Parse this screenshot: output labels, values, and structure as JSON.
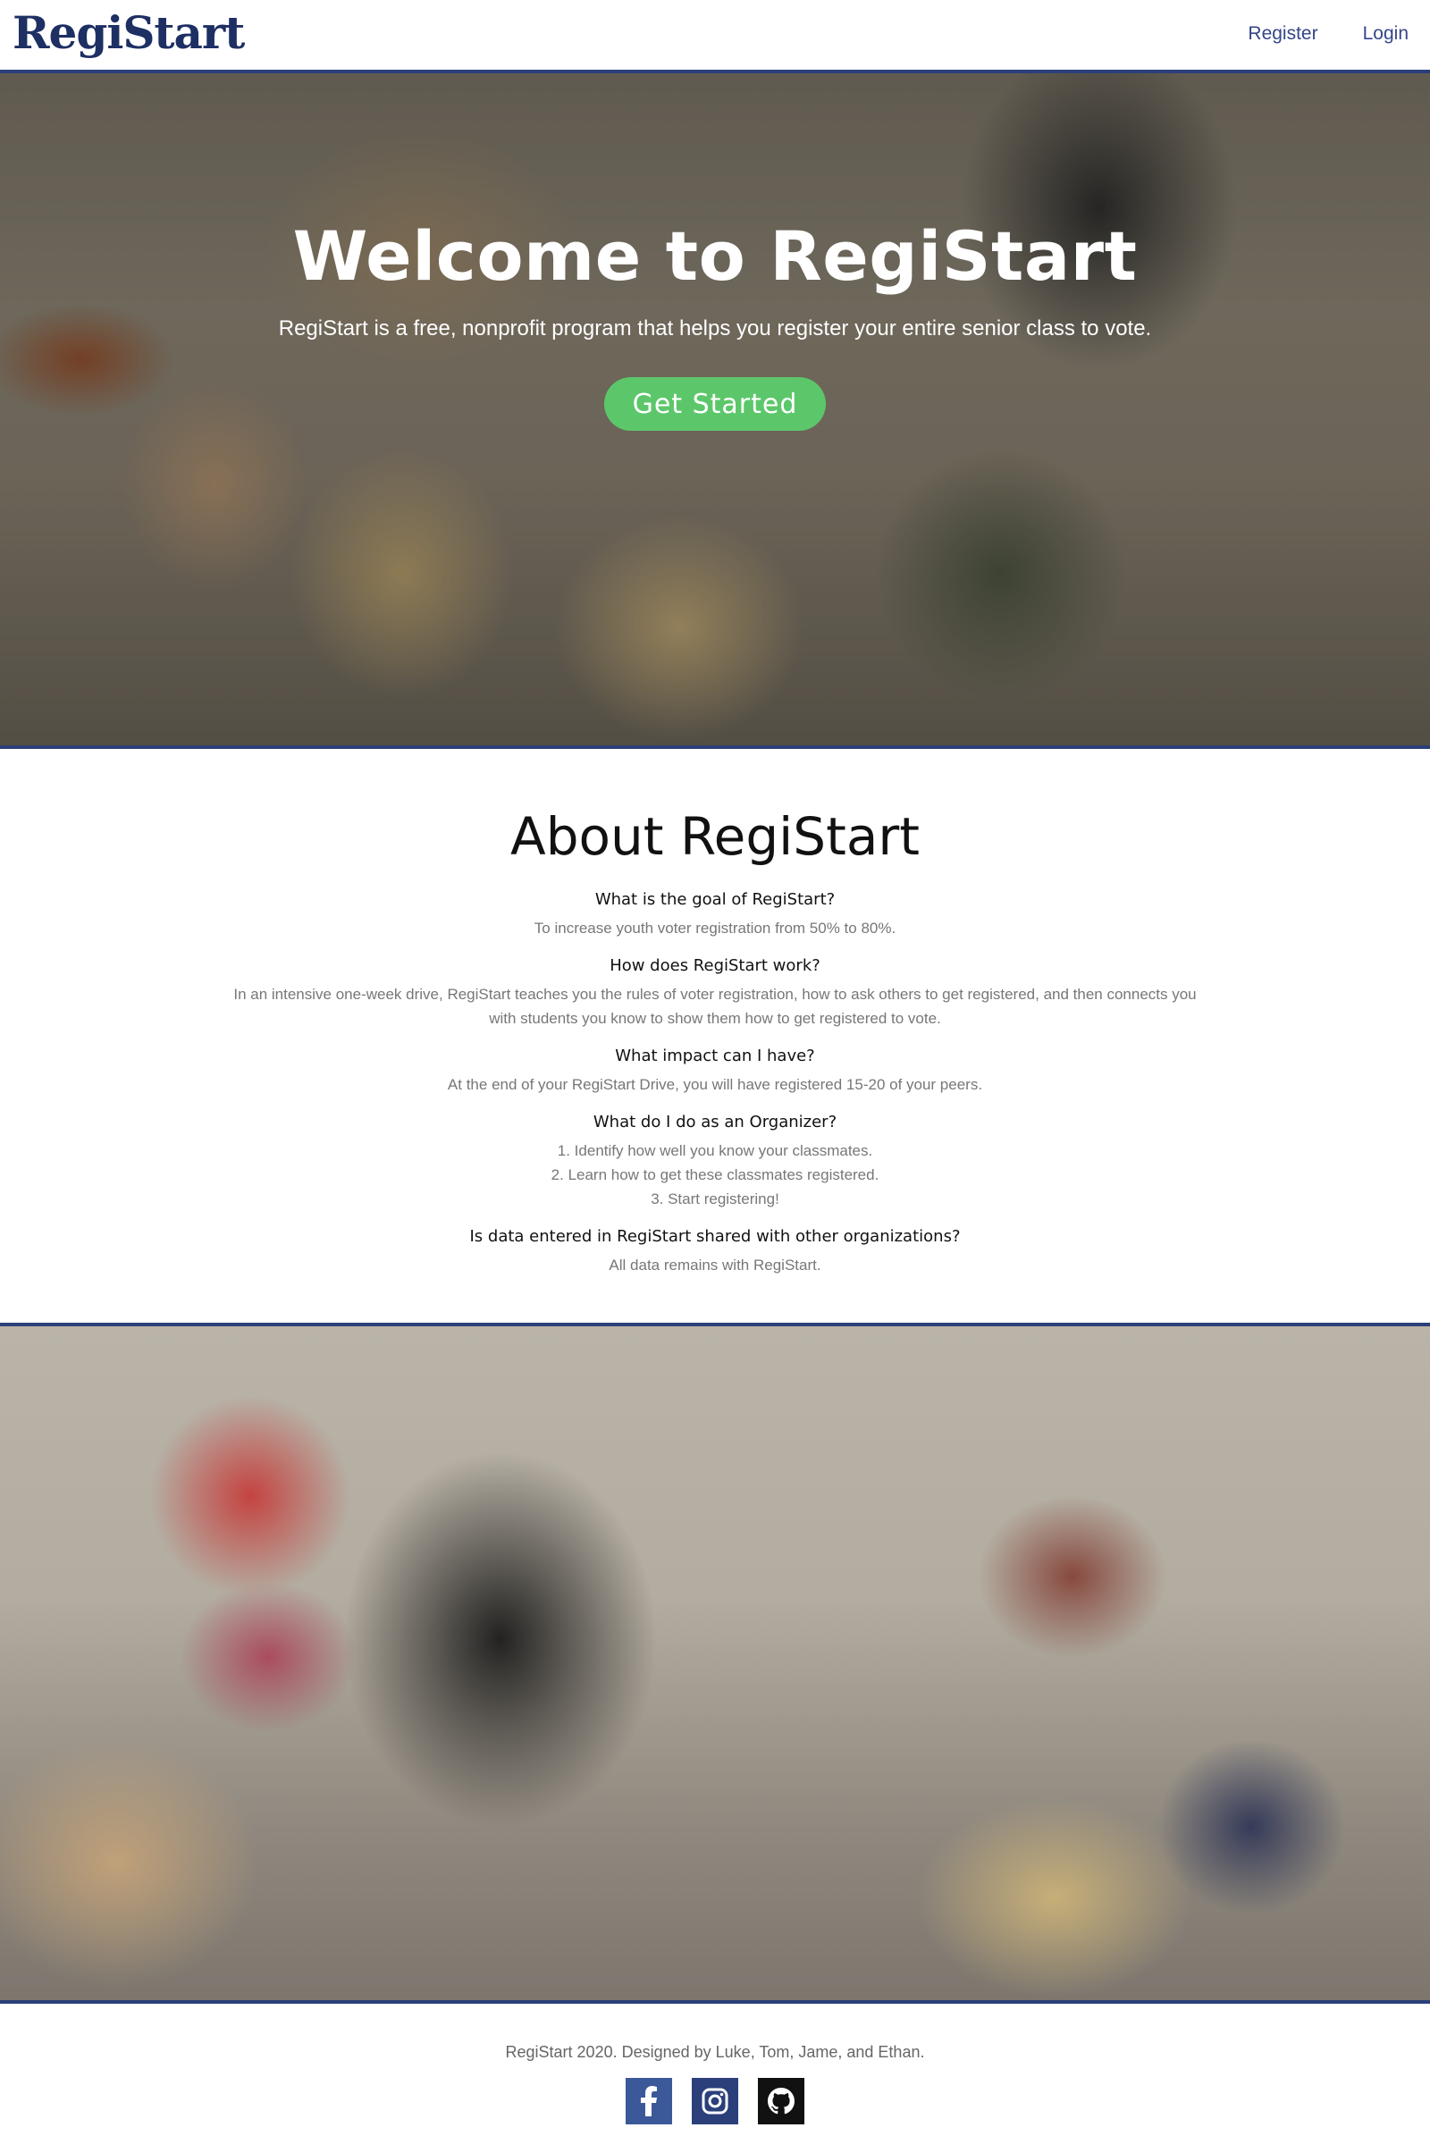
{
  "navbar": {
    "logo": "RegiStart",
    "links": [
      "Register",
      "Login"
    ]
  },
  "hero": {
    "title": "Welcome to RegiStart",
    "subtitle": "RegiStart is a free, nonprofit program that helps you register your entire senior class to vote.",
    "cta": "Get Started"
  },
  "about": {
    "title": "About RegiStart",
    "faq": [
      {
        "q": "What is the goal of RegiStart?",
        "a": [
          "To increase youth voter registration from 50% to 80%."
        ]
      },
      {
        "q": "How does RegiStart work?",
        "a": [
          "In an intensive one-week drive, RegiStart teaches you the rules of voter registration, how to ask others to get registered, and then connects you",
          "with students you know to show them how to get registered to vote."
        ]
      },
      {
        "q": "What impact can I have?",
        "a": [
          "At the end of your RegiStart Drive, you will have registered 15-20 of your peers."
        ]
      },
      {
        "q": "What do I do as an Organizer?",
        "a": [
          "1. Identify how well you know your classmates.",
          "2. Learn how to get these classmates registered.",
          "3. Start registering!"
        ]
      },
      {
        "q": "Is data entered in RegiStart shared with other organizations?",
        "a": [
          "All data remains with RegiStart."
        ]
      }
    ]
  },
  "footer": {
    "text": "RegiStart 2020. Designed by Luke, Tom, Jame, and Ethan.",
    "socials": [
      "facebook-icon",
      "instagram-icon",
      "github-icon"
    ]
  },
  "colors": {
    "brand_navy": "#1d2f63",
    "accent_green": "#5cc76a",
    "border_blue": "#2b3f7a"
  }
}
